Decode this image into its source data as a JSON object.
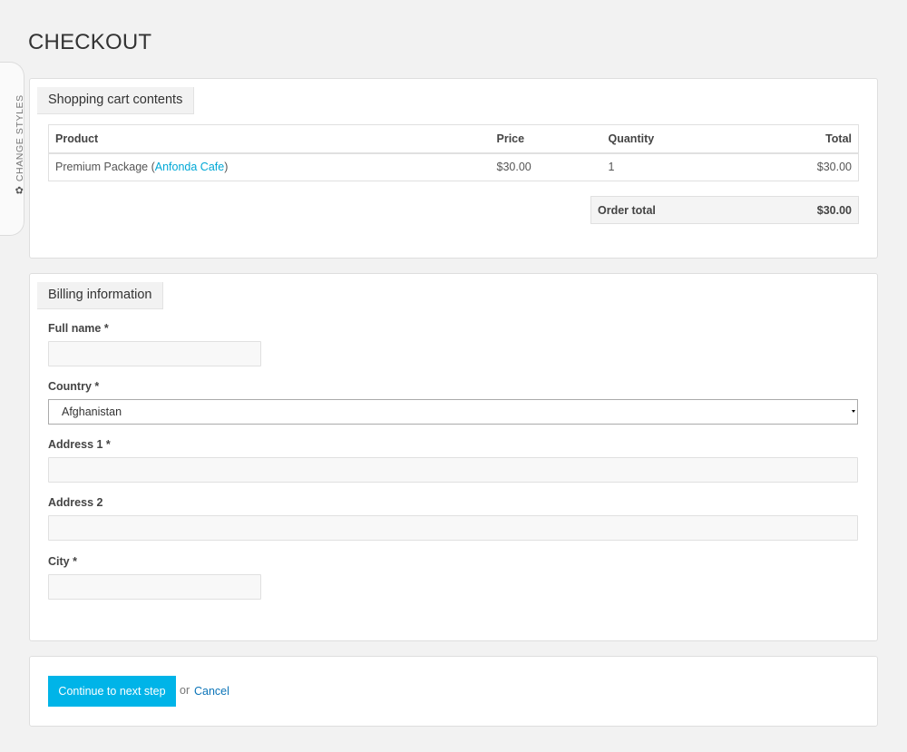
{
  "style_tab": {
    "label": "CHANGE STYLES",
    "icon": "gear-icon"
  },
  "page_title": "CHECKOUT",
  "cart": {
    "legend": "Shopping cart contents",
    "columns": [
      "Product",
      "Price",
      "Quantity",
      "Total"
    ],
    "rows": [
      {
        "product": "Premium Package",
        "product_link": "Anfonda Cafe",
        "price": "$30.00",
        "quantity": "1",
        "total": "$30.00"
      }
    ],
    "order_total_label": "Order total",
    "order_total_value": "$30.00"
  },
  "billing": {
    "legend": "Billing information",
    "full_name": {
      "label": "Full name *",
      "value": ""
    },
    "country": {
      "label": "Country *",
      "value": "Afghanistan"
    },
    "address1": {
      "label": "Address 1 *",
      "value": ""
    },
    "address2": {
      "label": "Address 2",
      "value": ""
    },
    "city": {
      "label": "City *",
      "value": ""
    }
  },
  "actions": {
    "continue_label": "Continue to next step",
    "or_text": "or",
    "cancel_label": "Cancel"
  },
  "colors": {
    "accent": "#00b4e8",
    "link": "#00a8d6",
    "background": "#f2f2f2"
  }
}
